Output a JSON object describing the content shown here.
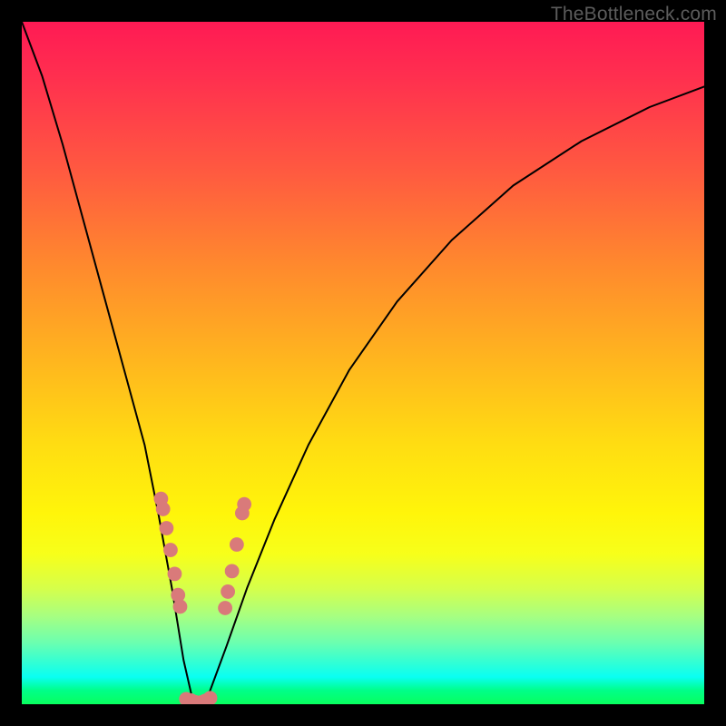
{
  "watermark": "TheBottleneck.com",
  "chart_data": {
    "type": "line",
    "title": "",
    "xlabel": "",
    "ylabel": "",
    "xlim": [
      0,
      100
    ],
    "ylim": [
      0,
      100
    ],
    "grid": false,
    "series": [
      {
        "name": "bottleneck-curve",
        "x": [
          0,
          3,
          6,
          9,
          12,
          15,
          18,
          20,
          22,
          23.7,
          25,
          26,
          27.3,
          30,
          33,
          37,
          42,
          48,
          55,
          63,
          72,
          82,
          92,
          100
        ],
        "y": [
          100,
          92,
          82,
          71,
          60,
          49,
          38,
          28,
          17,
          6.5,
          0.8,
          0.2,
          1.2,
          8.5,
          17,
          27,
          38,
          49,
          59,
          68,
          76,
          82.5,
          87.5,
          90.5
        ],
        "color": "#000000",
        "line_width": 2
      }
    ],
    "markers": {
      "name": "highlighted-points",
      "color": "#d97a7a",
      "radius_pct": 1.05,
      "points": [
        {
          "x": 20.4,
          "y": 30.1
        },
        {
          "x": 20.7,
          "y": 28.6
        },
        {
          "x": 21.2,
          "y": 25.8
        },
        {
          "x": 21.8,
          "y": 22.6
        },
        {
          "x": 22.4,
          "y": 19.1
        },
        {
          "x": 22.9,
          "y": 16.0
        },
        {
          "x": 23.2,
          "y": 14.3
        },
        {
          "x": 24.1,
          "y": 0.75
        },
        {
          "x": 24.8,
          "y": 0.55
        },
        {
          "x": 25.4,
          "y": 0.3
        },
        {
          "x": 26.2,
          "y": 0.25
        },
        {
          "x": 26.9,
          "y": 0.5
        },
        {
          "x": 27.6,
          "y": 0.9
        },
        {
          "x": 29.8,
          "y": 14.1
        },
        {
          "x": 30.2,
          "y": 16.5
        },
        {
          "x": 30.8,
          "y": 19.5
        },
        {
          "x": 31.5,
          "y": 23.4
        },
        {
          "x": 32.3,
          "y": 28.0
        },
        {
          "x": 32.6,
          "y": 29.3
        }
      ]
    }
  }
}
